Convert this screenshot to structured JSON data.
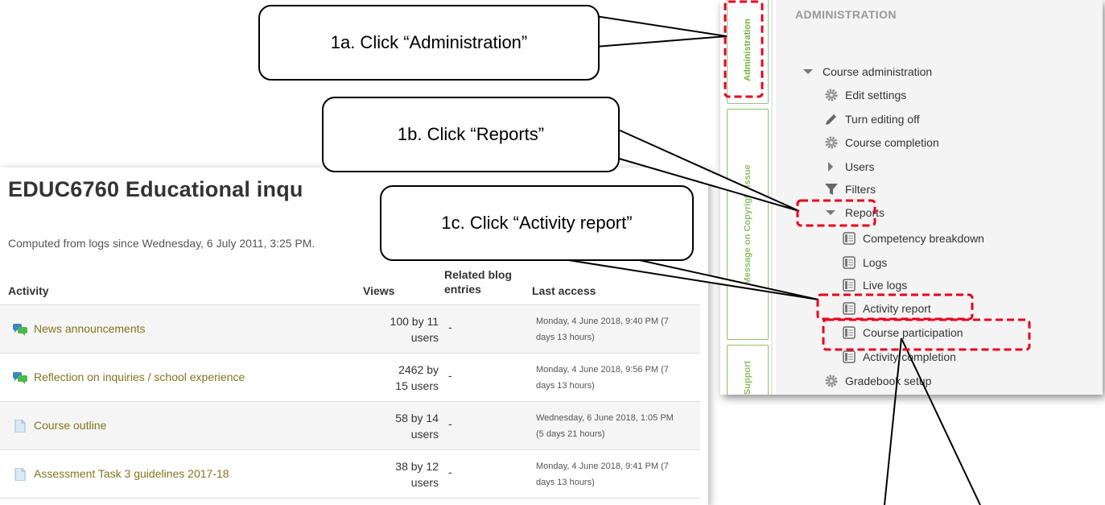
{
  "callouts": {
    "step_1a": "1a. Click “Administration”",
    "step_1b": "1b. Click “Reports”",
    "step_1c": "1c. Click “Activity report”"
  },
  "report": {
    "title": "EDUC6760 Educational inqu",
    "subtitle": "Computed from logs since Wednesday, 6 July 2011, 3:25 PM.",
    "columns": {
      "activity": "Activity",
      "views": "Views",
      "blog_line1": "Related blog",
      "blog_line2": "entries",
      "last_access": "Last access"
    },
    "rows": [
      {
        "icon": "forum-icon",
        "name": "News announcements",
        "views_1": "100 by 11",
        "views_2": "users",
        "blog": "-",
        "last_1": "Monday, 4 June 2018, 9:40 PM (7",
        "last_2": "days 13 hours)"
      },
      {
        "icon": "forum-icon",
        "name": "Reflection on inquiries / school experience",
        "views_1": "2462 by",
        "views_2": "15 users",
        "blog": "-",
        "last_1": "Monday, 4 June 2018, 9:56 PM (7",
        "last_2": "days 13 hours)"
      },
      {
        "icon": "file-icon",
        "name": "Course outline",
        "views_1": "58 by 14",
        "views_2": "users",
        "blog": "-",
        "last_1": "Wednesday, 6 June 2018, 1:05 PM",
        "last_2": "(5 days 21 hours)"
      },
      {
        "icon": "file-icon",
        "name": "Assessment Task 3 guidelines 2017-18",
        "views_1": "38 by 12",
        "views_2": "users",
        "blog": "-",
        "last_1": "Monday, 4 June 2018, 9:41 PM (7",
        "last_2": "days 13 hours)"
      }
    ]
  },
  "admin": {
    "tabs": {
      "administration": "Administration",
      "copyright": "Message on Copyright Issue",
      "support": "Support"
    },
    "heading": "ADMINISTRATION",
    "items": [
      {
        "key": "course_admin",
        "icon": "triangle-down-icon",
        "label": "Course administration"
      },
      {
        "key": "edit_settings",
        "icon": "gear-icon",
        "label": "Edit settings"
      },
      {
        "key": "turn_editing_off",
        "icon": "pencil-icon",
        "label": "Turn editing off"
      },
      {
        "key": "course_completion",
        "icon": "gear-icon",
        "label": "Course completion"
      },
      {
        "key": "users",
        "icon": "triangle-right-icon",
        "label": "Users"
      },
      {
        "key": "filters",
        "icon": "funnel-icon",
        "label": "Filters"
      },
      {
        "key": "reports",
        "icon": "triangle-down-icon",
        "label": "Reports"
      },
      {
        "key": "competency_breakdown",
        "icon": "report-icon",
        "label": "Competency breakdown"
      },
      {
        "key": "logs",
        "icon": "report-icon",
        "label": "Logs"
      },
      {
        "key": "live_logs",
        "icon": "report-icon",
        "label": "Live logs"
      },
      {
        "key": "activity_report",
        "icon": "report-icon",
        "label": "Activity report"
      },
      {
        "key": "course_participation",
        "icon": "report-icon",
        "label": "Course participation"
      },
      {
        "key": "activity_completion",
        "icon": "report-icon",
        "label": "Activity completion"
      },
      {
        "key": "gradebook_setup",
        "icon": "gear-icon",
        "label": "Gradebook setup"
      }
    ]
  },
  "colors": {
    "link": "#84741c",
    "highlight_dash": "#e8001c",
    "tab_green": "#8ec165"
  }
}
